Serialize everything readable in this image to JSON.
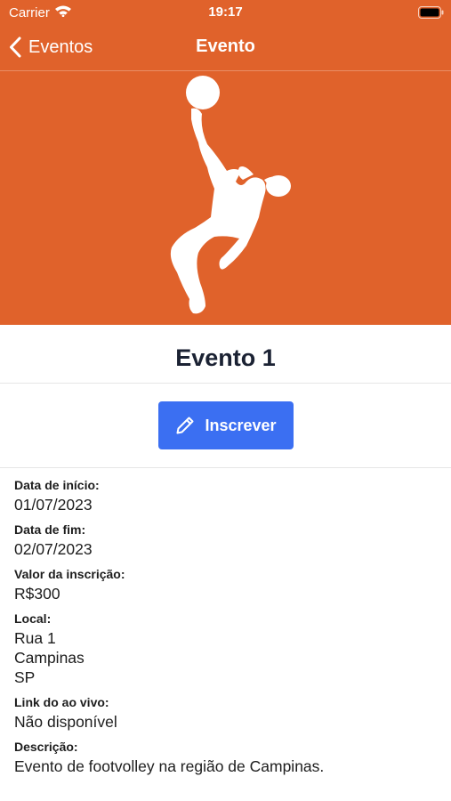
{
  "status_bar": {
    "carrier": "Carrier",
    "time": "19:17"
  },
  "nav": {
    "back_label": "Eventos",
    "title": "Evento"
  },
  "event": {
    "title": "Evento 1"
  },
  "actions": {
    "subscribe_label": "Inscrever"
  },
  "details": {
    "start_label": "Data de início:",
    "start_value": "01/07/2023",
    "end_label": "Data de fim:",
    "end_value": "02/07/2023",
    "fee_label": "Valor da inscrição:",
    "fee_value": "R$300",
    "location_label": "Local:",
    "location_street": "Rua 1",
    "location_city": "Campinas",
    "location_state": "SP",
    "live_label": "Link do ao vivo:",
    "live_value": "Não disponível",
    "description_label": "Descrição:",
    "description_value": "Evento de footvolley na região de Campinas."
  },
  "colors": {
    "header": "#e0622b",
    "button": "#3b6ff2",
    "title": "#1b2233"
  },
  "icons": {
    "wifi": "wifi-icon",
    "battery": "battery-icon",
    "back": "chevron-left-icon",
    "hero": "footvolley-player-icon",
    "edit": "pencil-icon"
  }
}
